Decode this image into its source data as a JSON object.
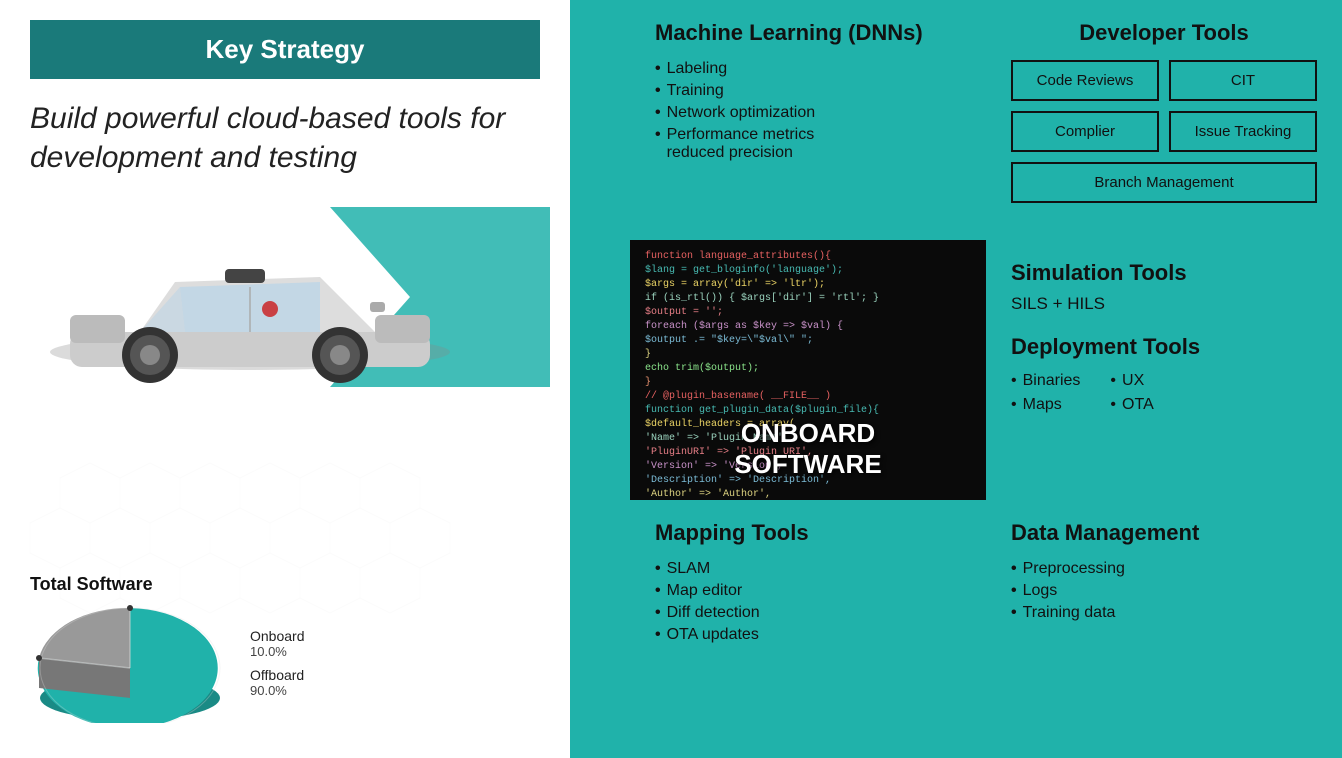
{
  "left": {
    "banner": "Key Strategy",
    "subtitle": "Build powerful cloud-based tools for development and testing",
    "pie": {
      "title": "Total Software",
      "onboard_label": "Onboard",
      "onboard_pct": "10.0%",
      "offboard_label": "Offboard",
      "offboard_pct": "90.0%"
    }
  },
  "ml": {
    "title": "Machine Learning (DNNs)",
    "items": [
      "Labeling",
      "Training",
      "Network optimization",
      "Performance metrics reduced precision"
    ]
  },
  "devtools": {
    "title": "Developer Tools",
    "buttons": [
      "Code Reviews",
      "CIT",
      "Complier",
      "Issue Tracking"
    ],
    "full_button": "Branch Management"
  },
  "onboard": {
    "label_line1": "ONBOARD",
    "label_line2": "SOFTWARE"
  },
  "simulation": {
    "title": "Simulation Tools",
    "subtitle": "SILS + HILS"
  },
  "deployment": {
    "title": "Deployment Tools",
    "col1": [
      "Binaries",
      "Maps"
    ],
    "col2": [
      "UX",
      "OTA"
    ]
  },
  "mapping": {
    "title": "Mapping Tools",
    "items": [
      "SLAM",
      "Map editor",
      "Diff detection",
      "OTA updates"
    ]
  },
  "datamgmt": {
    "title": "Data Management",
    "items": [
      "Preprocessing",
      "Logs",
      "Training data"
    ]
  }
}
